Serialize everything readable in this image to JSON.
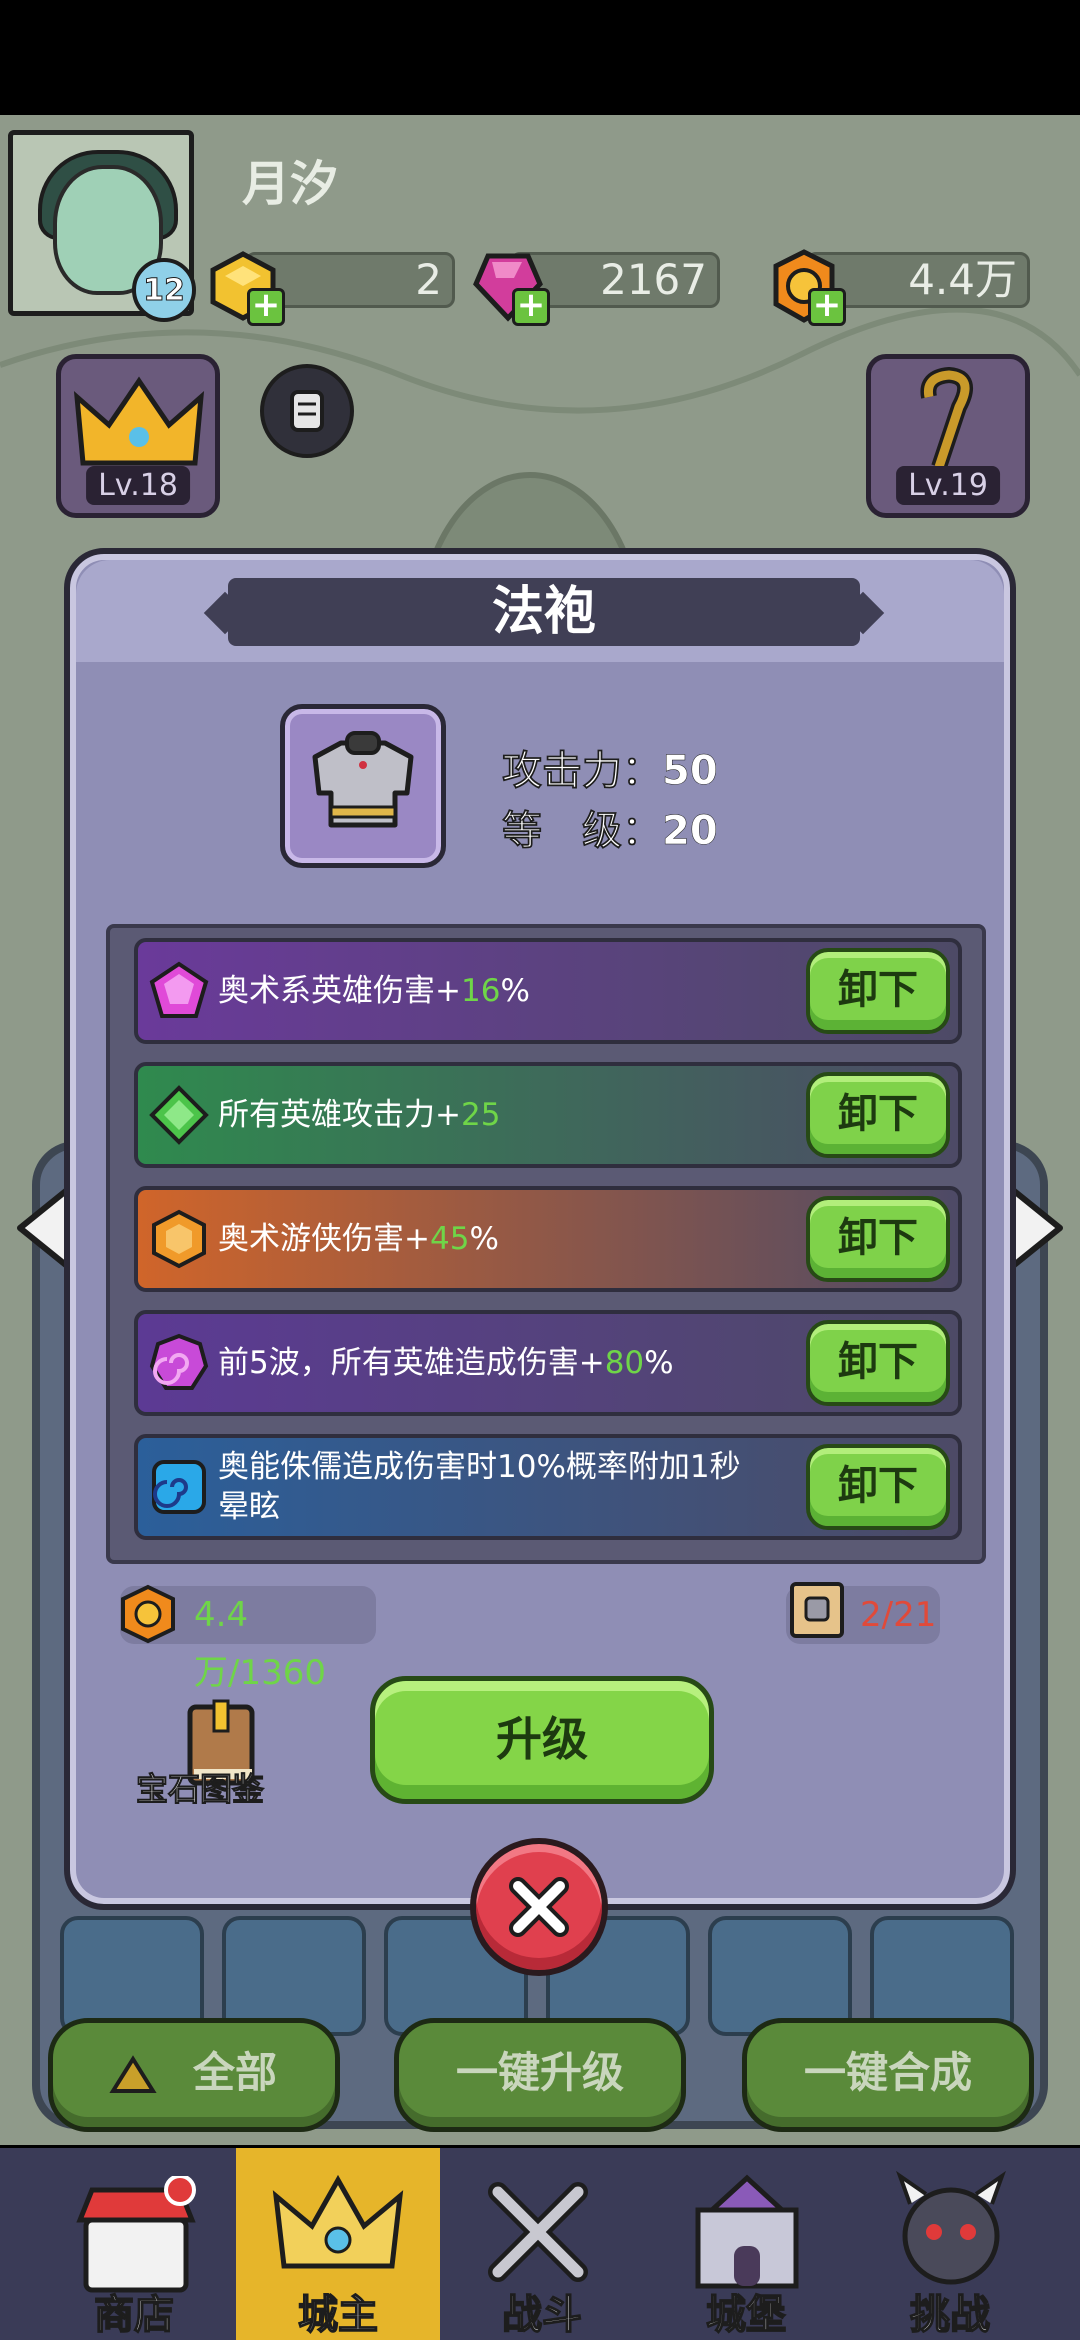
{
  "player": {
    "name": "月汐",
    "level": "12"
  },
  "currencies": [
    {
      "name": "gold-cube",
      "value": "2",
      "color": "#f2c230"
    },
    {
      "name": "pink-gem",
      "value": "2167",
      "color": "#d23d9c"
    },
    {
      "name": "coin",
      "value": "4.4万",
      "color": "#f08a1c"
    }
  ],
  "equipment_slots": {
    "left": {
      "level": "Lv.18",
      "icon": "crown-icon"
    },
    "right": {
      "level": "Lv.19",
      "icon": "staff-icon"
    }
  },
  "modal": {
    "title": "法袍",
    "stats": [
      {
        "label": "攻击力：",
        "value": "50"
      },
      {
        "label": "等　级：",
        "value": "20"
      }
    ],
    "gems": [
      {
        "text_prefix": "奥术系英雄伤害+",
        "highlight": "16",
        "suffix": "%",
        "bg": "linear-gradient(90deg,#6a3a9a,#4d4a66)",
        "icon": "purple-pentagon-gem-icon",
        "button": "卸下"
      },
      {
        "text_prefix": "所有英雄攻击力+",
        "highlight": "25",
        "suffix": "",
        "bg": "linear-gradient(90deg,#2f8a4e,#4d4a66)",
        "icon": "green-diamond-gem-icon",
        "button": "卸下"
      },
      {
        "text_prefix": "奥术游侠伤害+",
        "highlight": "45",
        "suffix": "%",
        "bg": "linear-gradient(90deg,#d0652a,#4d4a66)",
        "icon": "orange-hexagon-gem-icon",
        "button": "卸下"
      },
      {
        "text_prefix": "前5波，所有英雄造成伤害+",
        "highlight": "80",
        "suffix": "%",
        "bg": "linear-gradient(90deg,#5c3a94,#4d4a66)",
        "icon": "purple-swirl-gem-icon",
        "button": "卸下"
      },
      {
        "text_prefix": "奥能侏儒造成伤害时10%概率附加1秒晕眩",
        "highlight": "",
        "suffix": "",
        "bg": "linear-gradient(90deg,#2b5f9a,#4d4a66)",
        "icon": "blue-swirl-gem-icon",
        "button": "卸下"
      }
    ],
    "coin_cost": "4.4万/1360",
    "scroll_cost": "2/21",
    "gem_book_label": "宝石图鉴",
    "upgrade_label": "升级"
  },
  "bottom_buttons": [
    "全部",
    "一键升级",
    "一键合成"
  ],
  "tabs": [
    {
      "label": "商店",
      "icon": "shop-icon"
    },
    {
      "label": "城主",
      "icon": "crown-icon"
    },
    {
      "label": "战斗",
      "icon": "swords-icon"
    },
    {
      "label": "城堡",
      "icon": "castle-icon"
    },
    {
      "label": "挑战",
      "icon": "demon-icon"
    }
  ]
}
